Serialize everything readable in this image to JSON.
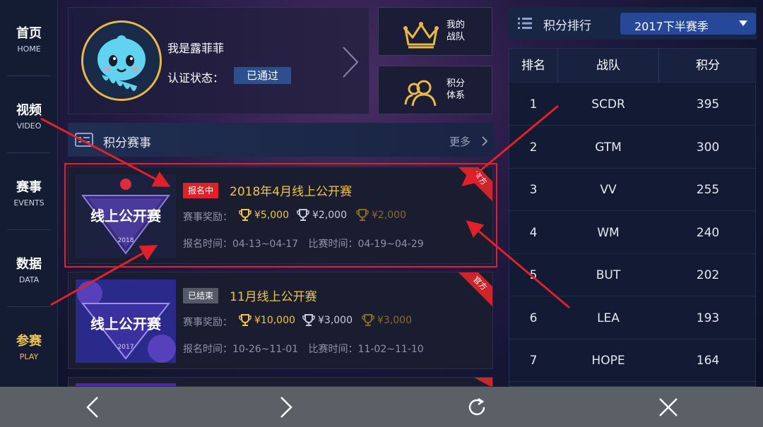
{
  "nav": {
    "items": [
      {
        "zh": "首页",
        "en": "HOME"
      },
      {
        "zh": "视频",
        "en": "VIDEO"
      },
      {
        "zh": "赛事",
        "en": "EVENTS"
      },
      {
        "zh": "数据",
        "en": "DATA"
      },
      {
        "zh": "参赛",
        "en": "PLAY"
      }
    ],
    "active_index": 4
  },
  "profile": {
    "name": "我是露菲菲",
    "cert_label": "认证状态：",
    "cert_status": "已通过"
  },
  "tiles": {
    "team": {
      "line1": "我的",
      "line2": "战队"
    },
    "points": {
      "line1": "积分",
      "line2": "体系"
    }
  },
  "section": {
    "title": "积分赛事",
    "more": "更多"
  },
  "events": [
    {
      "badge": "报名中",
      "title": "2018年4月线上公开赛",
      "prize_label": "赛事奖励：",
      "prizes": [
        "¥5,000",
        "¥2,000",
        "¥2,000"
      ],
      "signup_time": "报名时间：04-13~04-17",
      "match_time": "比赛时间：04-19~04-29",
      "ribbon": "官方",
      "thumb_text": "线上公开赛",
      "thumb_year": "2018"
    },
    {
      "badge": "已结束",
      "title": "11月线上公开赛",
      "prize_label": "赛事奖励：",
      "prizes": [
        "¥10,000",
        "¥3,000",
        "¥3,000"
      ],
      "signup_time": "报名时间：10-26~11-01",
      "match_time": "比赛时间：11-02~11-10",
      "ribbon": "官方",
      "thumb_text": "线上公开赛",
      "thumb_year": "2017"
    }
  ],
  "ranking": {
    "title": "积分排行",
    "season": "2017下半赛季",
    "headers": [
      "排名",
      "战队",
      "积分"
    ],
    "rows": [
      {
        "rank": "1",
        "team": "SCDR",
        "points": "395"
      },
      {
        "rank": "2",
        "team": "GTM",
        "points": "300"
      },
      {
        "rank": "3",
        "team": "VV",
        "points": "255"
      },
      {
        "rank": "4",
        "team": "WM",
        "points": "240"
      },
      {
        "rank": "5",
        "team": "BUT",
        "points": "202"
      },
      {
        "rank": "6",
        "team": "LEA",
        "points": "193"
      },
      {
        "rank": "7",
        "team": "HOPE",
        "points": "164"
      }
    ]
  },
  "colors": {
    "accent_gold": "#f0c34a",
    "badge_active": "#e1212a",
    "badge_ended": "#555a66",
    "highlight": "#e1212a"
  }
}
